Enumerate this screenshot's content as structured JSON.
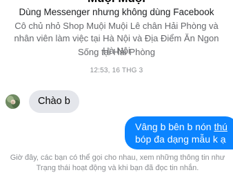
{
  "profile": {
    "name": "Muội Muội",
    "subtitle": "Dùng Messenger nhưng không dùng Facebook",
    "bio": "Cô chủ nhỏ Shop Muội Muội Lê chân Hải Phòng và nhân viên làm việc tại Hà Nội và Địa Điểm Ăn Ngon Hà Nội",
    "location": "Sống tại Hải Phòng"
  },
  "conversation": {
    "timestamp": "12:53, 16 THG 3",
    "messages": [
      {
        "direction": "incoming",
        "text": "Chào b"
      },
      {
        "direction": "outgoing",
        "text_before": "Vâng b bên b nón ",
        "text_underlined": "thú",
        "text_after": " bóp đa dạng mẫu k ạ"
      }
    ]
  },
  "notice": {
    "text": "Giờ đây, các bạn có thể gọi cho nhau, xem những thông tin như Trạng thái hoạt động và khi bạn đã đọc tin nhắn."
  },
  "colors": {
    "outgoing_bubble": "#0b84ff",
    "incoming_bubble": "#e4e6eb",
    "secondary_text": "#65676b"
  }
}
